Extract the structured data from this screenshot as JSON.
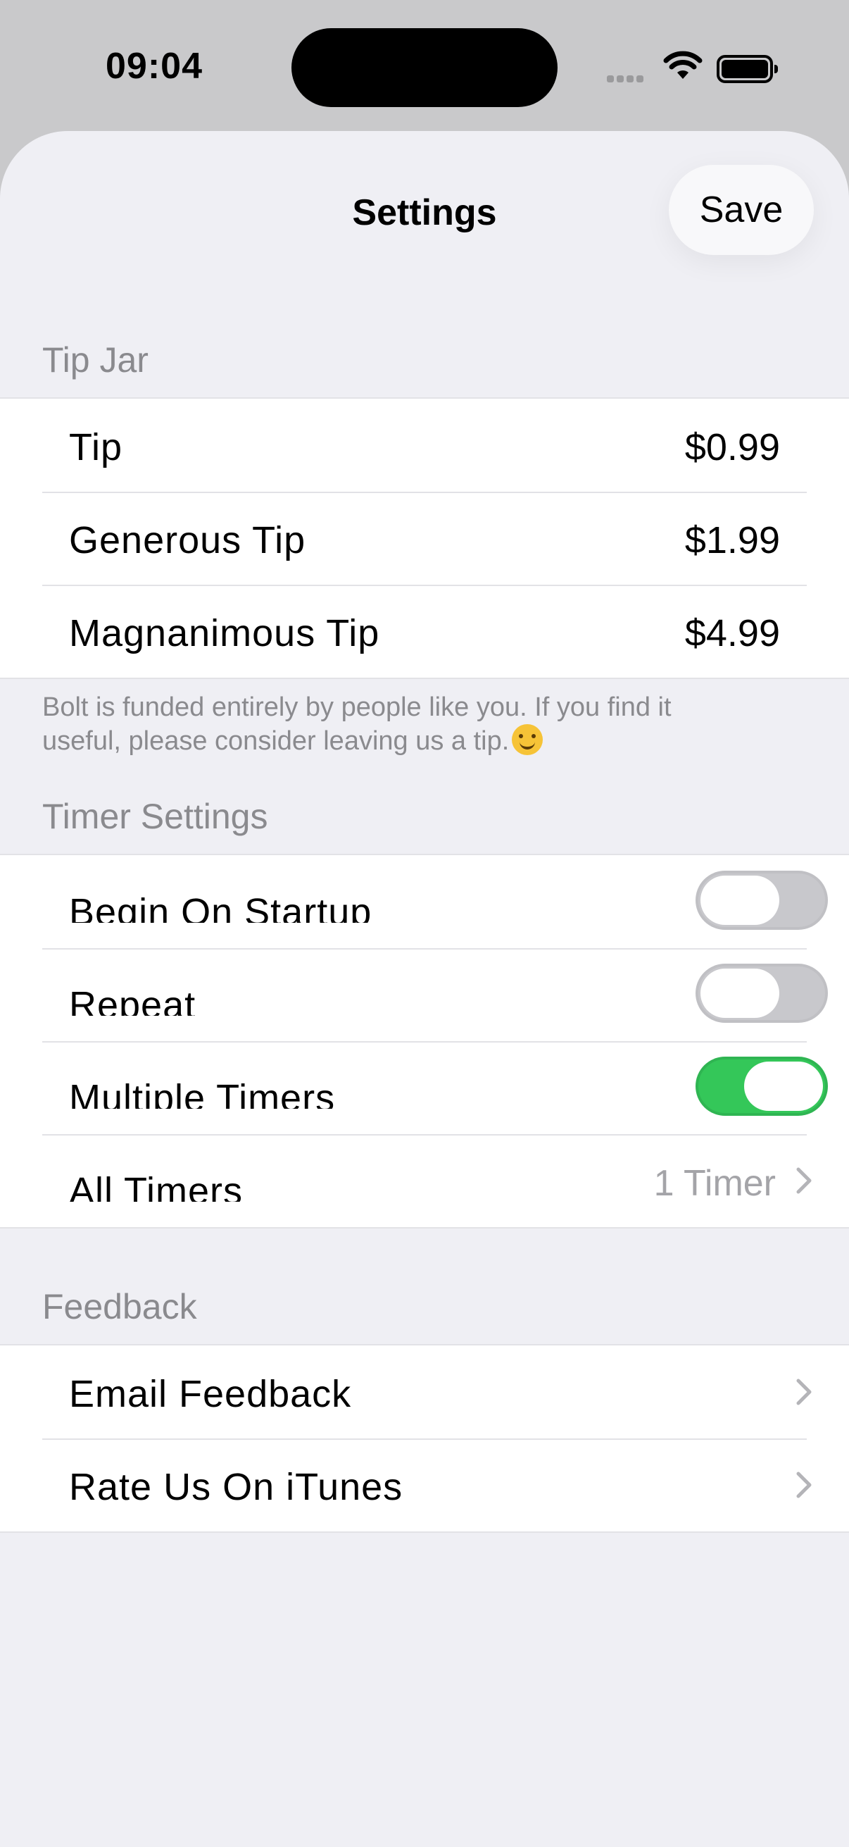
{
  "status_bar": {
    "time": "09:04"
  },
  "nav": {
    "title": "Settings",
    "save_label": "Save"
  },
  "tip_jar": {
    "header": "Tip Jar",
    "items": [
      {
        "label": "Tip",
        "price": "$0.99"
      },
      {
        "label": "Generous Tip",
        "price": "$1.99"
      },
      {
        "label": "Magnanimous Tip",
        "price": "$4.99"
      }
    ],
    "footer": "Bolt is funded entirely by people like you. If you find it useful, please consider leaving us a tip."
  },
  "timer_settings": {
    "header": "Timer Settings",
    "begin_on_startup": {
      "label": "Begin On Startup",
      "on": false
    },
    "repeat": {
      "label": "Repeat",
      "on": false
    },
    "multiple_timers": {
      "label": "Multiple Timers",
      "on": true
    },
    "all_timers": {
      "label": "All Timers",
      "detail": "1 Timer"
    }
  },
  "feedback": {
    "header": "Feedback",
    "items": [
      {
        "label": "Email Feedback"
      },
      {
        "label": "Rate Us On iTunes"
      }
    ]
  },
  "colors": {
    "toggle_on": "#34c759",
    "toggle_off": "#c8c8cc",
    "sheet_background": "#efeff4"
  },
  "icons": [
    "wifi-icon",
    "battery-icon",
    "cellular-signal-icon",
    "chevron-right-icon",
    "smiling-face-emoji"
  ]
}
